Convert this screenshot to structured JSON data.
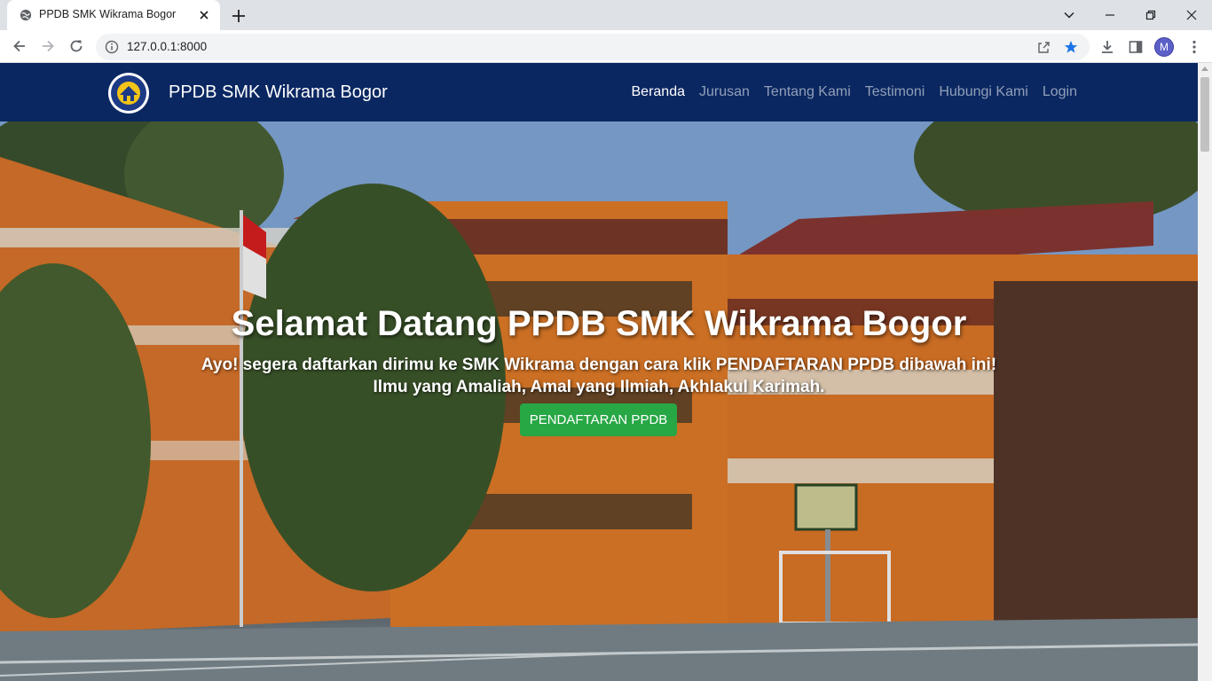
{
  "browser": {
    "tab_title": "PPDB SMK Wikrama Bogor",
    "url": "127.0.0.1:8000",
    "profile_initial": "M"
  },
  "navbar": {
    "brand": "PPDB SMK Wikrama Bogor",
    "menu": [
      {
        "label": "Beranda",
        "active": true
      },
      {
        "label": "Jurusan",
        "active": false
      },
      {
        "label": "Tentang Kami",
        "active": false
      },
      {
        "label": "Testimoni",
        "active": false
      },
      {
        "label": "Hubungi Kami",
        "active": false
      },
      {
        "label": "Login",
        "active": false
      }
    ]
  },
  "hero": {
    "title": "Selamat Datang PPDB SMK Wikrama Bogor",
    "subtitle_line1": "Ayo! segera daftarkan dirimu ke SMK Wikrama dengan cara klik PENDAFTARAN PPDB dibawah ini!",
    "subtitle_line2": "Ilmu yang Amaliah, Amal yang Ilmiah, Akhlakul Karimah.",
    "cta_label": "PENDAFTARAN PPDB"
  },
  "colors": {
    "navbar_bg": "#0a2761",
    "cta_bg": "#28a745",
    "bookmark_star": "#1a73e8"
  },
  "icons": {
    "tab_favicon": "globe-icon",
    "tab_close": "close-icon",
    "new_tab": "plus-icon",
    "back": "arrow-left-icon",
    "forward": "arrow-right-icon",
    "reload": "reload-icon",
    "site_info": "info-icon",
    "share": "share-icon",
    "bookmark": "star-icon",
    "download": "download-icon",
    "side_panel": "side-panel-icon",
    "tab_search": "chevron-down-icon",
    "minimize": "minimize-icon",
    "restore": "restore-icon",
    "close_window": "close-icon",
    "menu": "more-vert-icon"
  }
}
